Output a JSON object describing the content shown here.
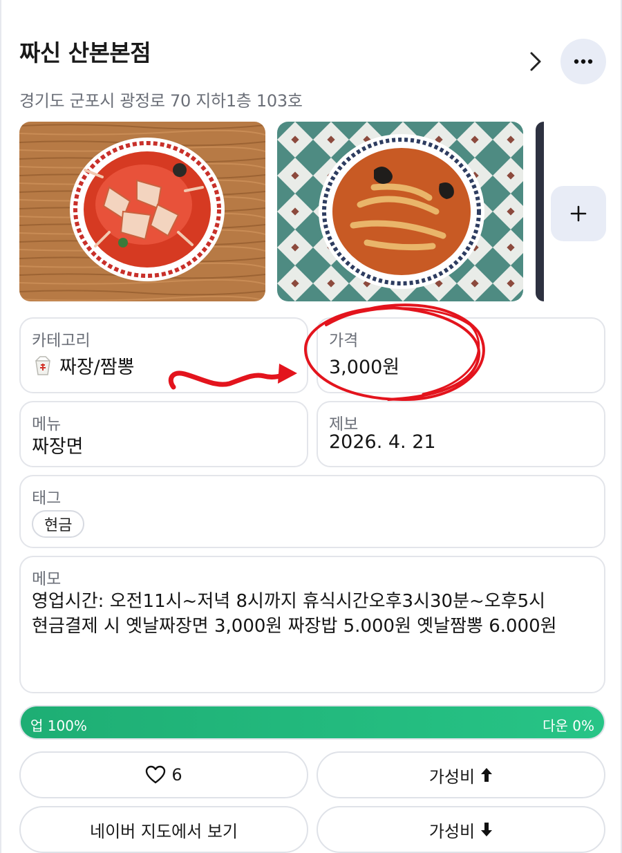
{
  "header": {
    "title": "짜신 산본본점",
    "address": "경기도 군포시 광정로 70 지하1층 103호",
    "chevron_icon": "chevron-right-icon",
    "more_icon": "more-horizontal-icon"
  },
  "photos": {
    "items": [
      "photo-jjamppong-crab",
      "photo-jjamppong-noodles"
    ],
    "add_icon": "plus-icon"
  },
  "info": {
    "category_label": "카테고리",
    "category_value": "짜장/짬뽕",
    "category_icon": "takeout-box-icon",
    "price_label": "가격",
    "price_value": "3,000원",
    "menu_label": "메뉴",
    "menu_value": "짜장면",
    "report_label": "제보",
    "report_value": "2026. 4. 21"
  },
  "tags": {
    "label": "태그",
    "items": [
      "현금"
    ]
  },
  "memo": {
    "label": "메모",
    "text": "영업시간: 오전11시~저녁 8시까지 휴식시간오후3시30분~오후5시\n현금결제 시 옛날짜장면 3,000원 짜장밥 5.000원 옛날짬뽕 6.000원"
  },
  "vote": {
    "up_label": "업 100%",
    "down_label": "다운 0%",
    "up_fraction": 1.0
  },
  "actions": {
    "like_count": "6",
    "value_up_label": "가성비",
    "value_down_label": "가성비",
    "map_label": "네이버 지도에서 보기"
  },
  "colors": {
    "accent_green": "#1eae74",
    "annotation_red": "#e3141d",
    "chip_bg": "#e8ecf6"
  }
}
